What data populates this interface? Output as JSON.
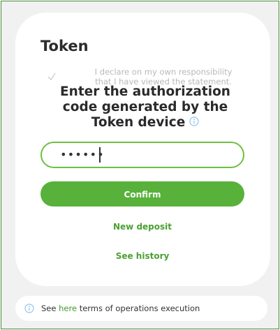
{
  "token_card": {
    "title": "Token",
    "declaration_line1": "I declare on my own responsibility",
    "declaration_line2": "that I have viewed the statement.",
    "heading_line1": "Enter the authorization",
    "heading_line2": "code generated by the",
    "heading_line3": "Token device",
    "code_value": "••••••",
    "confirm_label": "Confirm",
    "new_deposit_label": "New deposit",
    "see_history_label": "See history"
  },
  "terms": {
    "prefix": "See",
    "link_label": "here",
    "suffix": "terms of operations execution"
  },
  "colors": {
    "accent_green": "#58b13a",
    "link_green": "#4aa032",
    "info_blue": "#8ec4e8",
    "frame_border": "#4a8a3c"
  },
  "icons": {
    "checkmark": "check-icon",
    "info": "info-icon"
  }
}
